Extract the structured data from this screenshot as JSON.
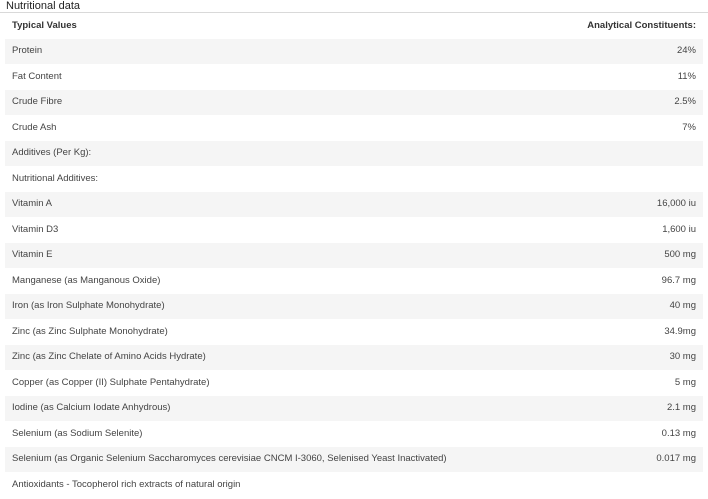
{
  "section_title": "Nutritional data",
  "table": {
    "headers": {
      "left": "Typical Values",
      "right": "Analytical Constituents:"
    },
    "rows": [
      {
        "label": "Protein",
        "value": "24%"
      },
      {
        "label": "Fat Content",
        "value": "11%"
      },
      {
        "label": "Crude Fibre",
        "value": "2.5%"
      },
      {
        "label": "Crude Ash",
        "value": "7%"
      },
      {
        "label": "Additives (Per Kg):",
        "value": ""
      },
      {
        "label": "Nutritional Additives:",
        "value": ""
      },
      {
        "label": "Vitamin A",
        "value": "16,000 iu"
      },
      {
        "label": "Vitamin D3",
        "value": "1,600 iu"
      },
      {
        "label": "Vitamin E",
        "value": "500 mg"
      },
      {
        "label": "Manganese (as Manganous Oxide)",
        "value": "96.7 mg"
      },
      {
        "label": "Iron (as Iron Sulphate Monohydrate)",
        "value": "40 mg"
      },
      {
        "label": "Zinc (as Zinc Sulphate Monohydrate)",
        "value": "34.9mg"
      },
      {
        "label": "Zinc (as Zinc Chelate of Amino Acids Hydrate)",
        "value": "30 mg"
      },
      {
        "label": "Copper (as Copper (II) Sulphate Pentahydrate)",
        "value": "5 mg"
      },
      {
        "label": "Iodine (as Calcium Iodate Anhydrous)",
        "value": "2.1 mg"
      },
      {
        "label": "Selenium (as Sodium Selenite)",
        "value": "0.13 mg"
      },
      {
        "label": "Selenium (as Organic Selenium Saccharomyces cerevisiae CNCM I-3060, Selenised Yeast Inactivated)",
        "value": "0.017 mg"
      },
      {
        "label": "Antioxidants - Tocopherol rich extracts of natural origin",
        "value": ""
      }
    ]
  }
}
